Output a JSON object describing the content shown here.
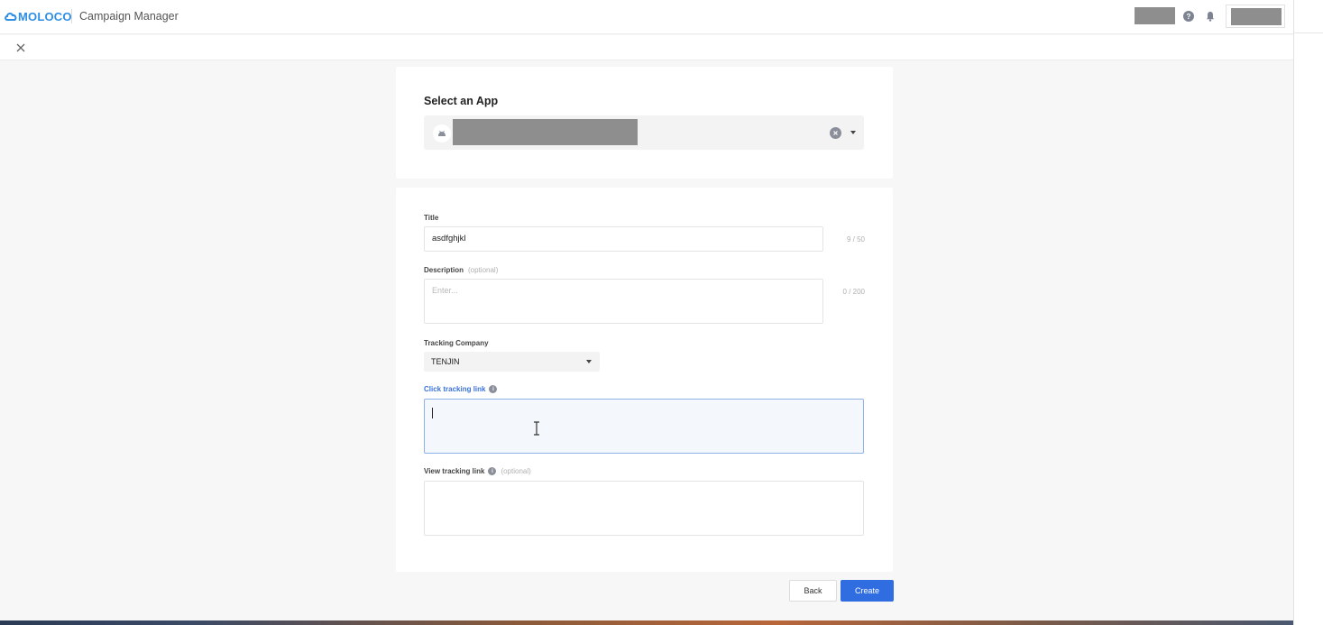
{
  "header": {
    "logo_text": "MOLOCO",
    "app_title": "Campaign Manager",
    "icons": [
      "help-icon",
      "bell-icon"
    ]
  },
  "subheader": {
    "close_icon": "close-icon"
  },
  "select_app": {
    "title": "Select an App",
    "platform_icon": "android-icon"
  },
  "form": {
    "title": {
      "label": "Title",
      "value": "asdfghjkl",
      "counter": "9 / 50"
    },
    "description": {
      "label": "Description",
      "optional": "(optional)",
      "placeholder": "Enter...",
      "counter": "0 / 200"
    },
    "tracking_company": {
      "label": "Tracking Company",
      "selected": "TENJIN"
    },
    "click_tracking": {
      "label": "Click tracking link",
      "value": ""
    },
    "view_tracking": {
      "label": "View tracking link",
      "optional": "(optional)",
      "value": ""
    }
  },
  "actions": {
    "back_label": "Back",
    "create_label": "Create"
  },
  "colors": {
    "brand": "#2d8ee6",
    "primary_button": "#2f6de0",
    "focus_border": "#8fb2e6",
    "label_focus": "#3a73d8"
  }
}
